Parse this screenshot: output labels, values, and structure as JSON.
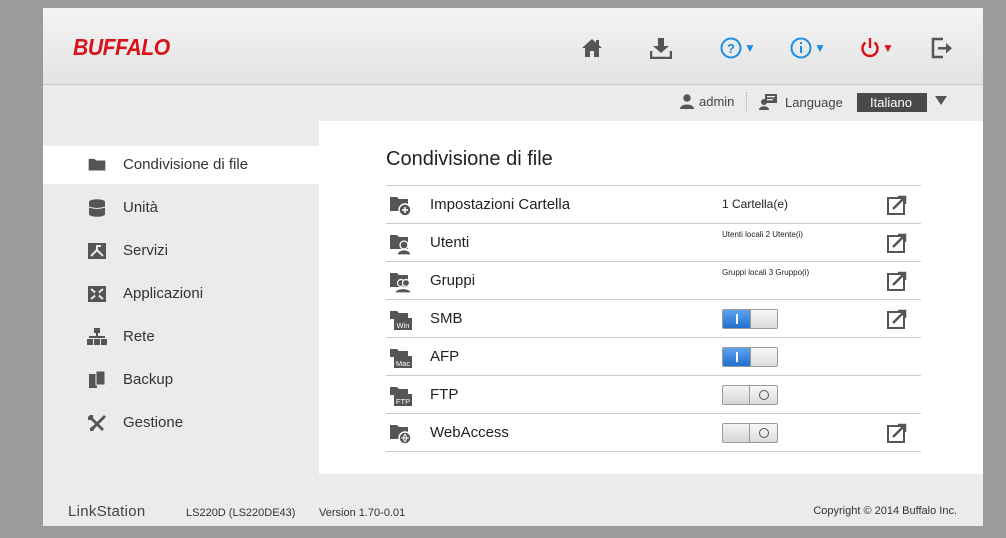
{
  "brand": {
    "logo": "BUFFALO",
    "color": "#d7141a"
  },
  "toolbar": {
    "icons": [
      "home-icon",
      "download-icon",
      "help-icon",
      "info-icon",
      "power-icon",
      "logout-icon"
    ],
    "help_caret": "▼",
    "info_caret": "▼",
    "power_caret": "▼",
    "accent": "#1a8fe3"
  },
  "subbar": {
    "user": "admin",
    "language_label": "Language",
    "language_value": "Italiano"
  },
  "sidebar": {
    "items": [
      {
        "label": "Condivisione di file",
        "icon": "folder-icon",
        "active": true
      },
      {
        "label": "Unità",
        "icon": "disk-icon"
      },
      {
        "label": "Servizi",
        "icon": "services-icon"
      },
      {
        "label": "Applicazioni",
        "icon": "applications-icon"
      },
      {
        "label": "Rete",
        "icon": "network-icon"
      },
      {
        "label": "Backup",
        "icon": "backup-icon"
      },
      {
        "label": "Gestione",
        "icon": "tools-icon"
      }
    ]
  },
  "main": {
    "title": "Condivisione di file",
    "rows": [
      {
        "label": "Impostazioni Cartella",
        "value": "1 Cartella(e)",
        "icon": "folder-add-icon"
      },
      {
        "label": "Utenti",
        "value": "Utenti locali 2 Utente(i)",
        "icon": "folder-user-icon"
      },
      {
        "label": "Gruppi",
        "value": "Gruppi locali 3 Gruppo(i)",
        "icon": "folder-group-icon"
      },
      {
        "label": "SMB",
        "toggle": "on",
        "icon": "folder-win-icon",
        "win_tag": "Win"
      },
      {
        "label": "AFP",
        "toggle": "on",
        "icon": "folder-mac-icon",
        "mac_tag": "Mac"
      },
      {
        "label": "FTP",
        "toggle": "off",
        "icon": "folder-ftp-icon",
        "ftp_tag": "FTP"
      },
      {
        "label": "WebAccess",
        "toggle": "off",
        "icon": "folder-web-icon"
      }
    ]
  },
  "footer": {
    "brand": "LinkStation",
    "model": "LS220D (LS220DE43)",
    "version": "Version 1.70-0.01",
    "copyright": "Copyright © 2014 Buffalo Inc."
  }
}
